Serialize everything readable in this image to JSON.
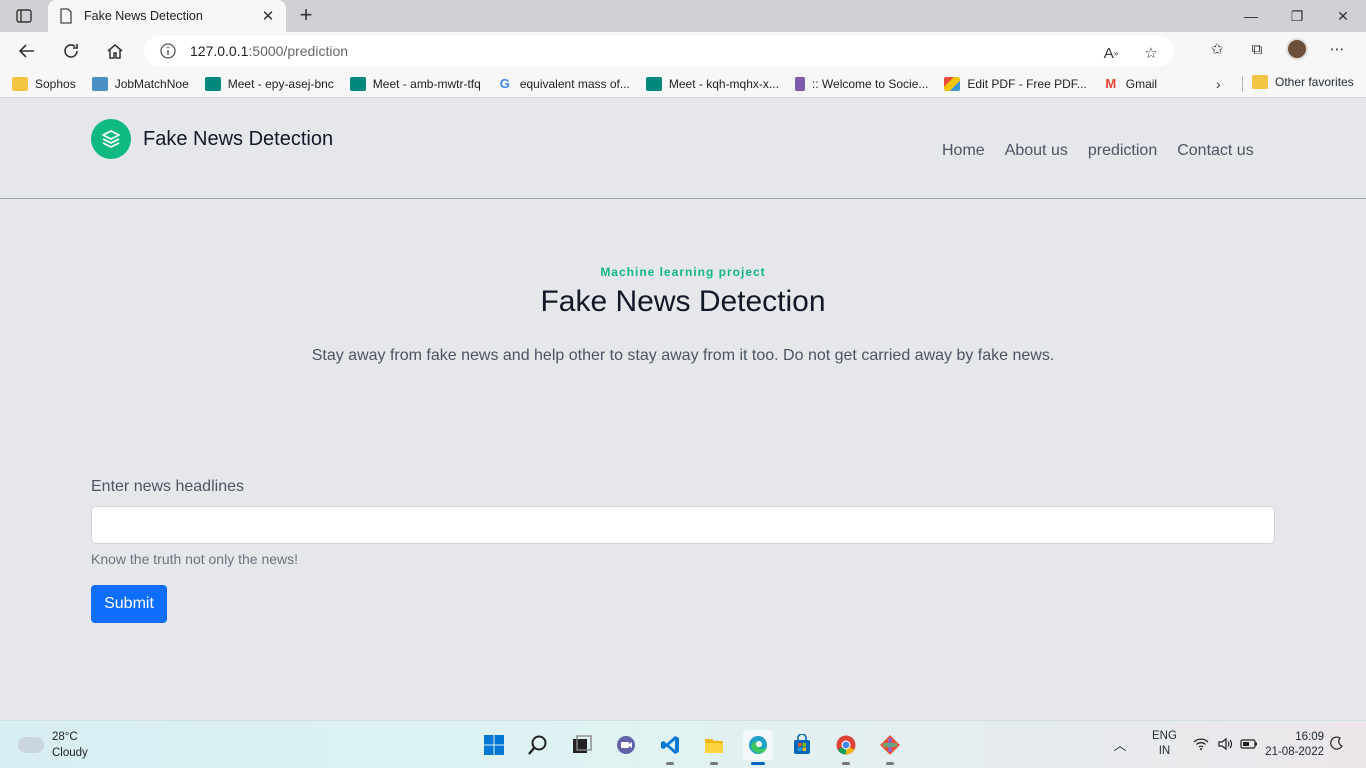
{
  "browser": {
    "tab": {
      "title": "Fake News Detection",
      "close_glyph": "✕"
    },
    "new_tab_glyph": "+",
    "window_controls": {
      "minimize": "—",
      "maximize": "❐",
      "close": "✕"
    },
    "address": {
      "host": "127.0.0.1",
      "path": ":5000/prediction"
    },
    "bookmarks": [
      {
        "label": "Sophos",
        "icon": "folder-icon",
        "color": "#f4c542"
      },
      {
        "label": "JobMatchNoe",
        "icon": "jobmatch-icon",
        "color": "#4a90c2"
      },
      {
        "label": "Meet - epy-asej-bnc",
        "icon": "meet-icon",
        "color": "#00897b"
      },
      {
        "label": "Meet - amb-mwtr-tfq",
        "icon": "meet-icon",
        "color": "#00897b"
      },
      {
        "label": "equivalent mass of...",
        "icon": "google-icon",
        "color": "#4285f4"
      },
      {
        "label": "Meet - kqh-mqhx-x...",
        "icon": "meet-icon",
        "color": "#00897b"
      },
      {
        "label": ":: Welcome to Socie...",
        "icon": "building-icon",
        "color": "#7a5ca8"
      },
      {
        "label": "Edit PDF - Free PDF...",
        "icon": "pdf-icon",
        "color": "#e84c3d"
      },
      {
        "label": "Gmail",
        "icon": "gmail-icon",
        "color": "#ea4335"
      }
    ],
    "bookmarks_overflow": "›",
    "other_favorites": "Other favorites"
  },
  "site": {
    "brand": "Fake News Detection",
    "brand_color": "#10b981",
    "nav": [
      "Home",
      "About us",
      "prediction",
      "Contact us"
    ]
  },
  "hero": {
    "kicker": "Machine learning project",
    "title": "Fake News Detection",
    "subtitle": "Stay away from fake news and help other to stay away from it too. Do not get carried away by fake news."
  },
  "form": {
    "label": "Enter news headlines",
    "value": "",
    "help": "Know the truth not only the news!",
    "submit_label": "Submit",
    "submit_color": "#0d6efd"
  },
  "taskbar": {
    "weather": {
      "temp": "28°C",
      "condition": "Cloudy"
    },
    "apps": [
      "windows-start-icon",
      "search-icon",
      "task-view-icon",
      "teams-chat-icon",
      "vscode-icon",
      "file-explorer-icon",
      "edge-icon",
      "store-icon",
      "chrome-icon",
      "git-icon"
    ],
    "tray": {
      "lang": "ENG",
      "region": "IN"
    },
    "clock": {
      "time": "16:09",
      "date": "21-08-2022"
    }
  }
}
